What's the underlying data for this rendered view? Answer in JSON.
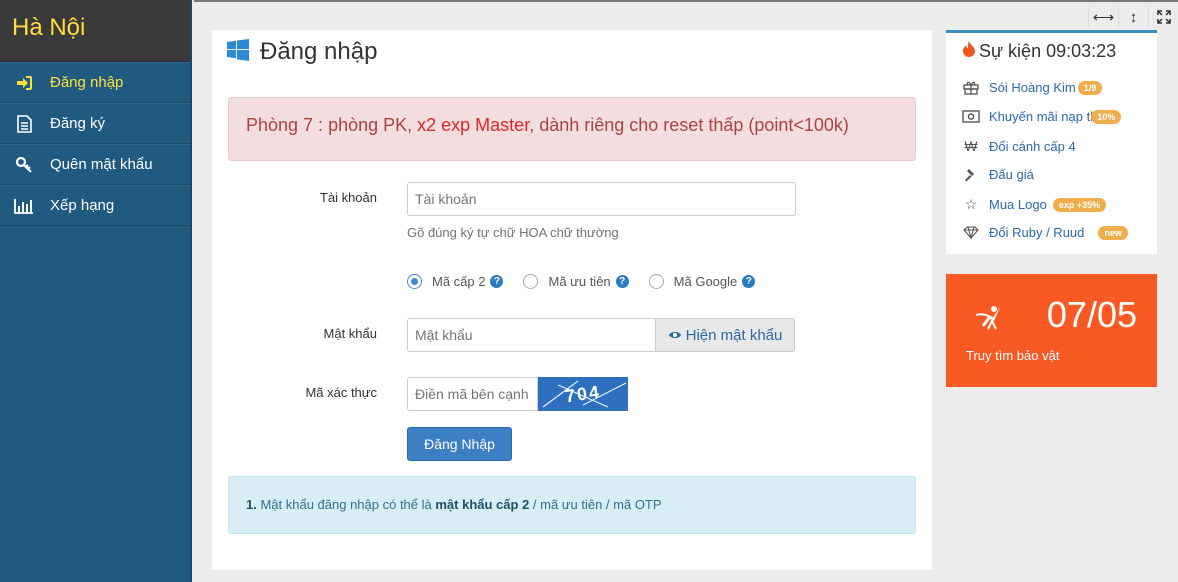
{
  "sidebar": {
    "brand": "Hà Nội",
    "items": [
      {
        "label": "Đăng nhập",
        "icon": "sign-in-icon",
        "active": true
      },
      {
        "label": "Đăng ký",
        "icon": "document-icon"
      },
      {
        "label": "Quên mật khẩu",
        "icon": "key-icon"
      },
      {
        "label": "Xếp hạng",
        "icon": "bar-chart-icon"
      }
    ]
  },
  "toolbar": {
    "icons": [
      "horizontal-resize-icon",
      "vertical-resize-icon",
      "fullscreen-icon"
    ]
  },
  "login": {
    "title": "Đăng nhập",
    "notice": {
      "prefix": "Phòng 7 : phòng PK, ",
      "highlight": "x2 exp Master",
      "suffix": ", dành riêng cho reset thấp (point<100k)"
    },
    "account_label": "Tài khoản",
    "account_placeholder": "Tài khoản",
    "account_help": "Gõ đúng ký tự chữ HOA chữ thường",
    "code_options": [
      "Mã cấp 2",
      "Mã ưu tiên",
      "Mã Google"
    ],
    "selected_code": "Mã cấp 2",
    "password_label": "Mật khẩu",
    "password_placeholder": "Mật khẩu",
    "show_password": "Hiện mật khẩu",
    "captcha_label": "Mã xác thực",
    "captcha_placeholder": "Điền mã bên cạnh",
    "captcha_text": "704",
    "submit": "Đăng Nhập",
    "info": {
      "number": "1.",
      "prefix": " Mật khẩu đăng nhập có thể là ",
      "bold": "mật khẩu cấp 2",
      "suffix": " / mã ưu tiên / mã OTP"
    }
  },
  "events": {
    "title": "Sự kiện 09:03:23",
    "items": [
      {
        "label": "Sói Hoàng Kim",
        "icon": "gift-icon",
        "badge": "1/9"
      },
      {
        "label": "Khuyến mãi nạp th",
        "icon": "money-icon",
        "badge": "10%"
      },
      {
        "label": "Đổi cánh cấp 4",
        "icon": "won-icon",
        "badge": ""
      },
      {
        "label": "Đấu giá",
        "icon": "gavel-icon",
        "badge": ""
      },
      {
        "label": "Mua Logo",
        "icon": "star-icon",
        "badge": "exp +35%"
      },
      {
        "label": "Đổi Ruby / Ruud",
        "icon": "diamond-icon",
        "badge": "new"
      }
    ]
  },
  "treasure": {
    "number": "07/05",
    "label": "Truy tìm bảo vật",
    "color": "#f95a24"
  }
}
